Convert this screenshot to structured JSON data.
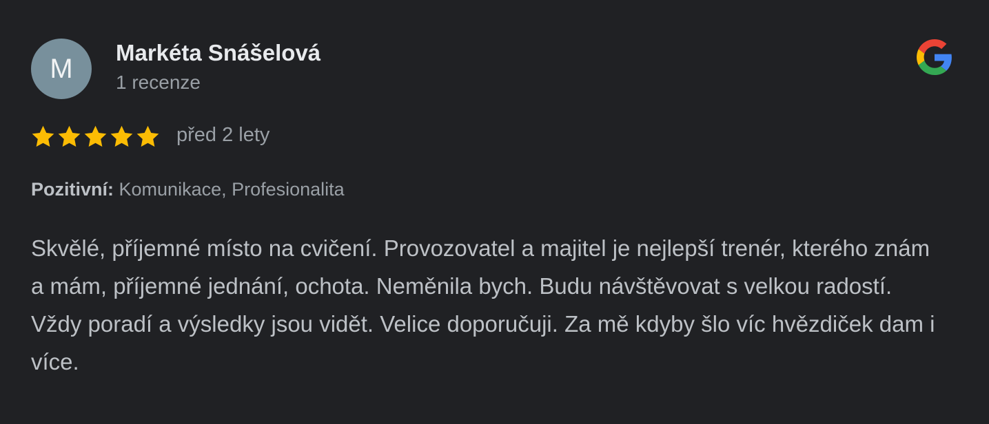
{
  "reviewer": {
    "initial": "M",
    "name": "Markéta Snášelová",
    "review_count": "1 recenze",
    "avatar_color": "#78909c"
  },
  "logo": {
    "icon": "google-g-icon"
  },
  "rating": {
    "stars": 5,
    "max_stars": 5,
    "star_color": "#fbbc04",
    "date": "před 2 lety"
  },
  "positives": {
    "label": "Pozitivní:",
    "values": "Komunikace, Profesionalita"
  },
  "review": {
    "text": "Skvělé, příjemné místo na cvičení. Provozovatel a majitel je nejlepší trenér, kterého znám a mám, příjemné jednání, ochota. Neměnila bych. Budu návštěvovat s velkou radostí. Vždy poradí a výsledky jsou vidět. Velice doporučuji. Za mě kdyby šlo víc hvězdiček dam i více."
  }
}
